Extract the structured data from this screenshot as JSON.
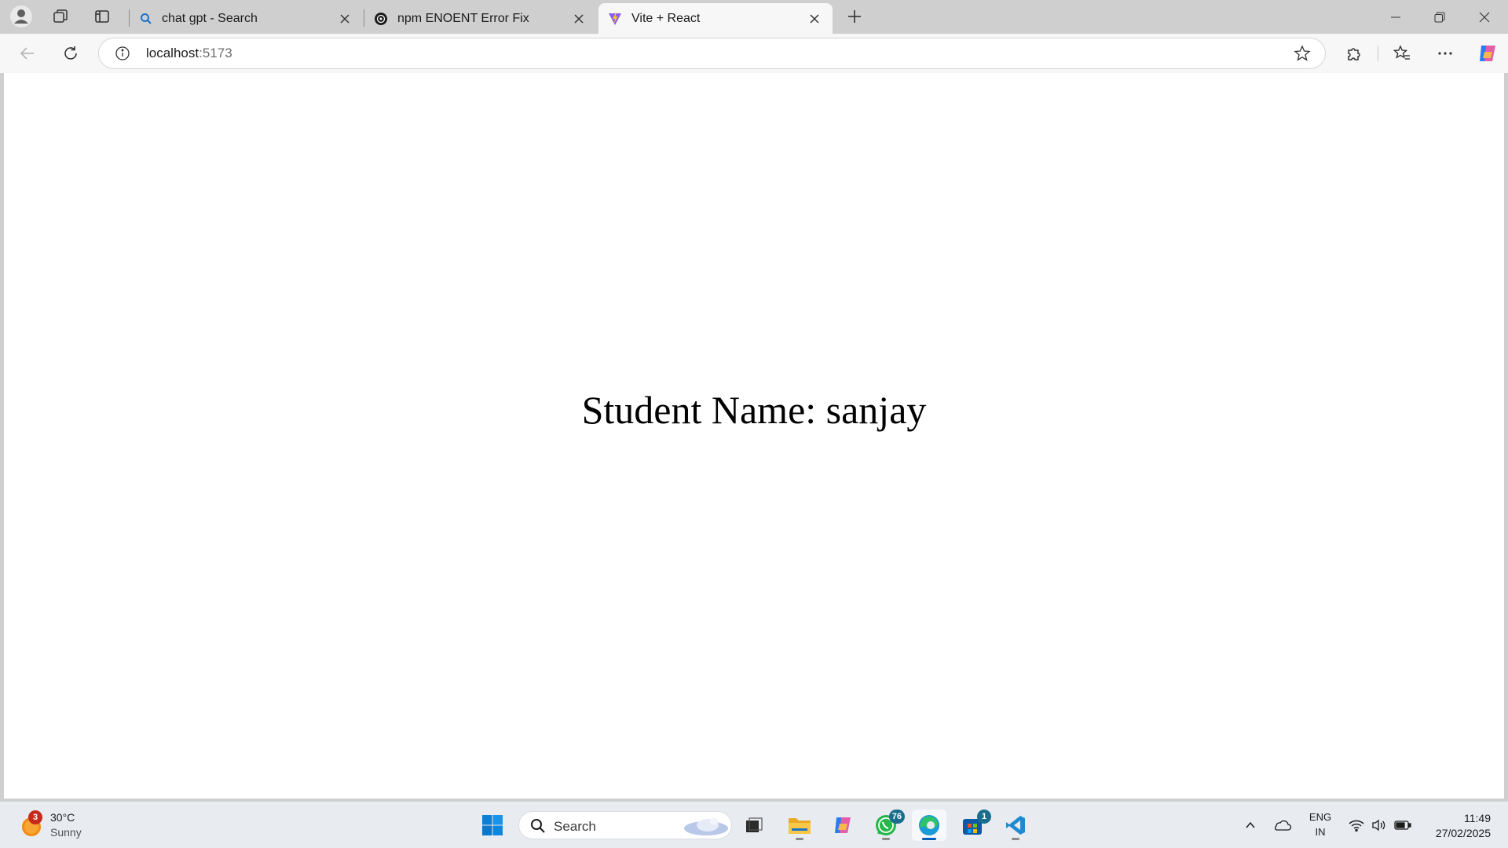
{
  "browser": {
    "tabs": [
      {
        "title": "chat gpt - Search",
        "icon": "search-icon",
        "active": false
      },
      {
        "title": "npm ENOENT Error Fix",
        "icon": "chatgpt-icon",
        "active": false
      },
      {
        "title": "Vite + React",
        "icon": "vite-icon",
        "active": true
      }
    ],
    "address": {
      "host": "localhost",
      "port": ":5173"
    }
  },
  "page": {
    "student_text": "Student Name: sanjay"
  },
  "taskbar": {
    "weather": {
      "temp": "30°C",
      "condition": "Sunny",
      "badge": "3"
    },
    "search_label": "Search",
    "whatsapp_badge": "76",
    "store_badge": "1",
    "language": {
      "line1": "ENG",
      "line2": "IN"
    },
    "clock": {
      "time": "11:49",
      "date": "27/02/2025"
    }
  }
}
